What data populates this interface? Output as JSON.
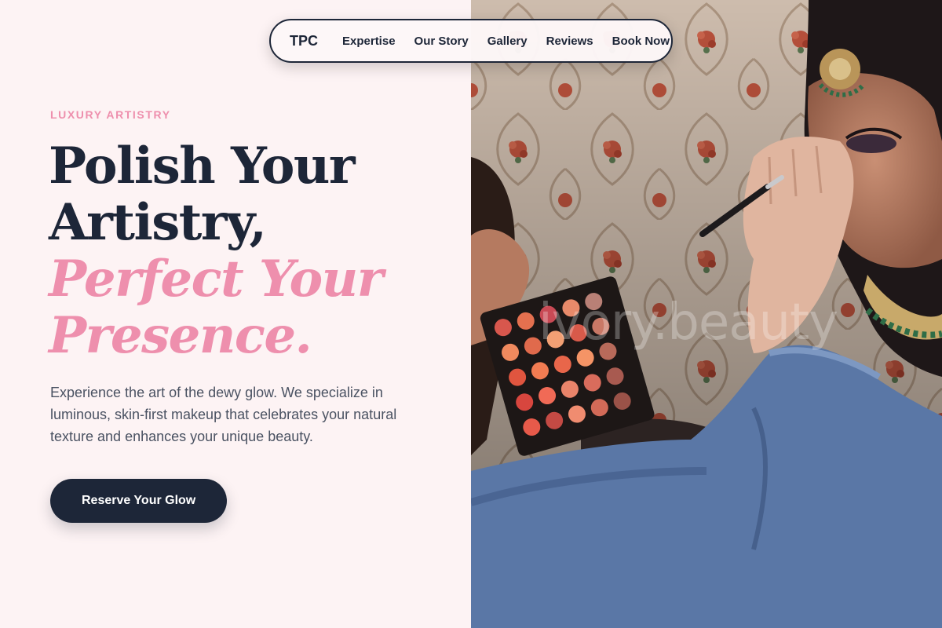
{
  "nav": {
    "brand": "TPC",
    "links": [
      "Expertise",
      "Our Story",
      "Gallery",
      "Reviews",
      "Book Now"
    ]
  },
  "hero": {
    "eyebrow": "LUXURY ARTISTRY",
    "headline_lines": [
      "Polish Your",
      "Artistry,",
      "Perfect Your",
      "Presence."
    ],
    "lede": "Experience the art of the dewy glow. We specialize in luminous, skin-first makeup that celebrates your natural texture and enhances your unique beauty.",
    "cta_label": "Reserve Your Glow"
  },
  "image": {
    "watermark": "ivory.beauty"
  },
  "colors": {
    "background": "#fdf3f4",
    "navy": "#1d2638",
    "pink_accent": "#ee8fad",
    "body_text": "#4a5262"
  }
}
